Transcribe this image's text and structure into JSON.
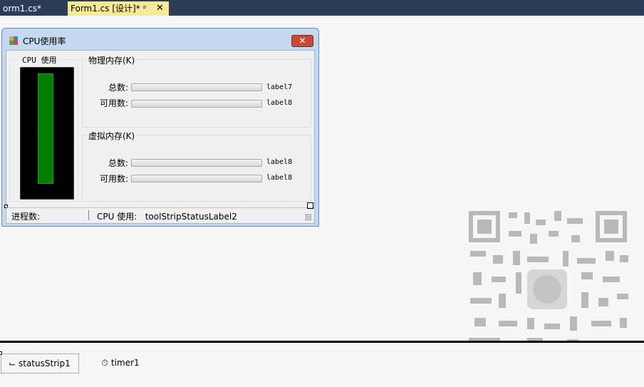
{
  "tabs": [
    {
      "label": "orm1.cs*",
      "active": false
    },
    {
      "label": "Form1.cs [设计]*",
      "active": true,
      "pin": "ᵖ",
      "close": "✕"
    }
  ],
  "form": {
    "title": "CPU使用率",
    "close_glyph": "✕",
    "cpu_group": {
      "title": "CPU 使用",
      "bar_color": "#008000"
    },
    "physical": {
      "title": "物理内存(K)",
      "rows": [
        {
          "label": "总数:",
          "value": "label7"
        },
        {
          "label": "可用数:",
          "value": "label8"
        }
      ]
    },
    "virtual": {
      "title": "虚拟内存(K)",
      "rows": [
        {
          "label": "总数:",
          "value": "label8"
        },
        {
          "label": "可用数:",
          "value": "label8"
        }
      ]
    },
    "status": {
      "left": "进程数:",
      "right": "CPU 使用:   toolStripStatusLabel2"
    }
  },
  "tray": {
    "items": [
      {
        "label": "statusStrip1",
        "icon": "status-strip-icon"
      },
      {
        "label": "timer1",
        "icon": "timer-icon"
      }
    ]
  },
  "colors": {
    "tabstrip": "#2b3c59",
    "active_tab": "#f7e99a",
    "cpu_bar": "#008000"
  }
}
